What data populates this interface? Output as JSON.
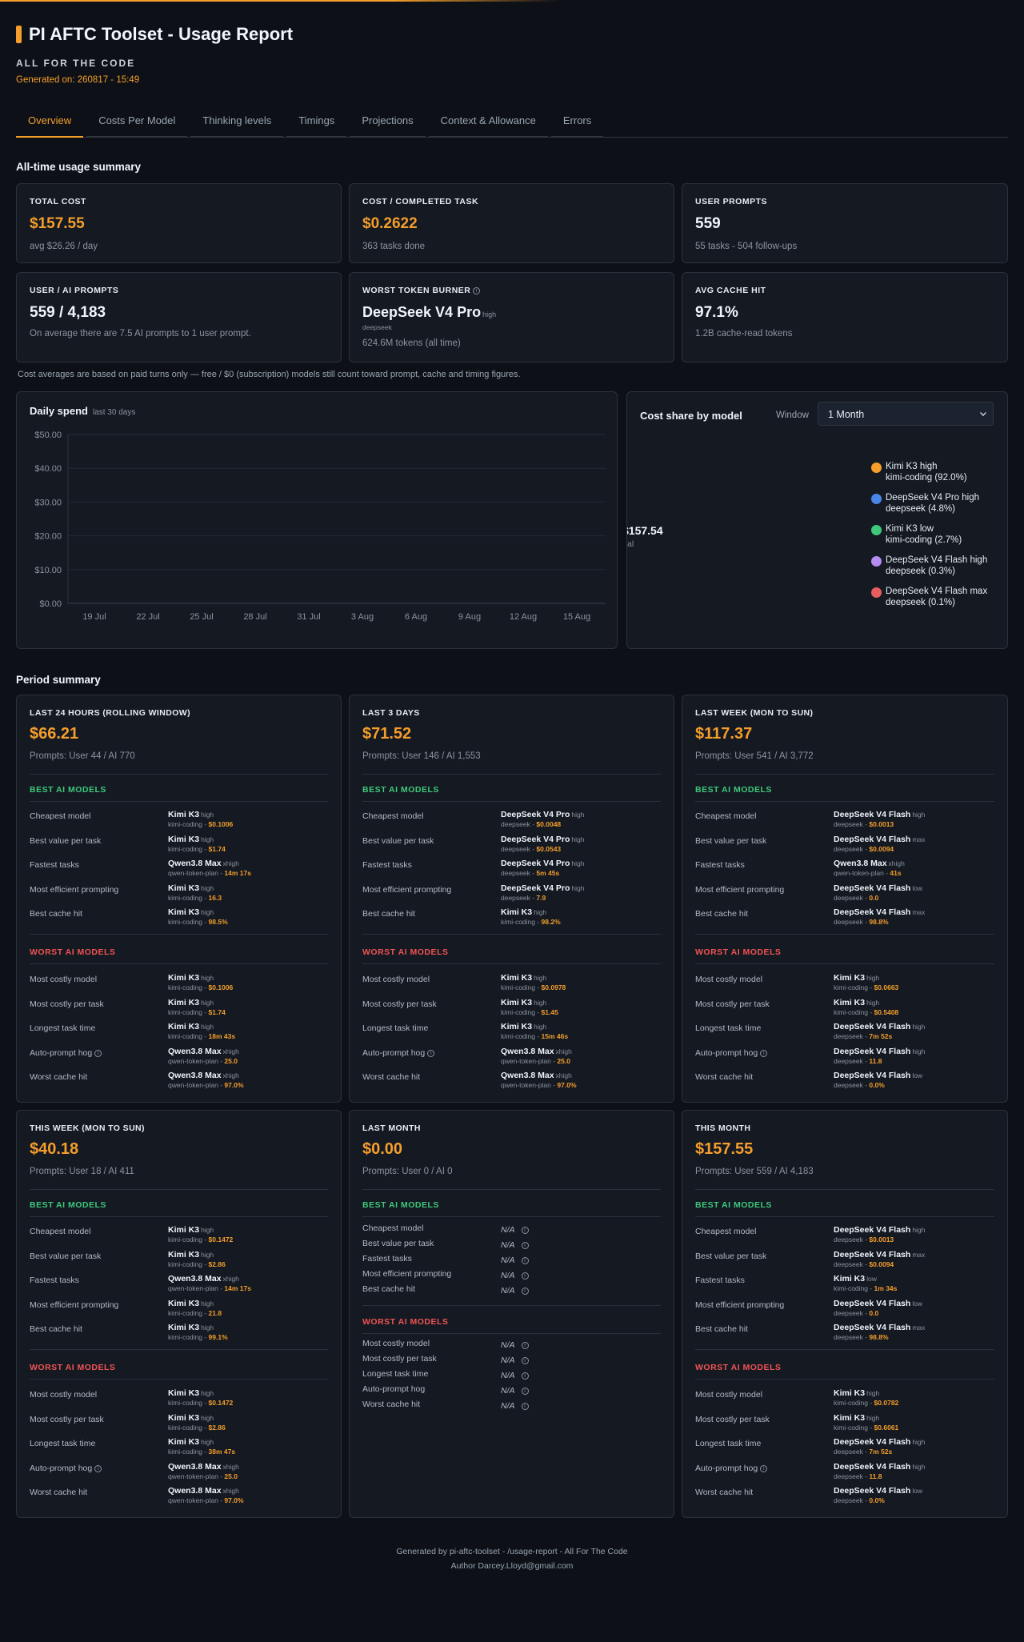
{
  "header": {
    "title": "PI AFTC Toolset - Usage Report",
    "subtitle": "ALL FOR THE CODE",
    "generated": "Generated on: 260817 - 15:49"
  },
  "tabs": [
    "Overview",
    "Costs Per Model",
    "Thinking levels",
    "Timings",
    "Projections",
    "Context & Allowance",
    "Errors"
  ],
  "summary": {
    "title": "All-time usage summary",
    "total_cost": {
      "label": "TOTAL COST",
      "value": "$157.55",
      "sub": "avg $26.26 / day"
    },
    "cost_per_task": {
      "label": "COST / COMPLETED TASK",
      "value": "$0.2622",
      "sub": "363 tasks done"
    },
    "user_prompts": {
      "label": "USER PROMPTS",
      "value": "559",
      "sub": "55 tasks - 504 follow-ups"
    },
    "user_ai": {
      "label": "USER / AI PROMPTS",
      "value": "559 / 4,183",
      "sub": "On average there are 7.5 AI prompts to 1 user prompt."
    },
    "worst_burner": {
      "label": "WORST TOKEN BURNER",
      "model": "DeepSeek V4 Pro",
      "level": "high",
      "provider": "deepseek",
      "sub": "624.6M tokens (all time)"
    },
    "cache_hit": {
      "label": "AVG CACHE HIT",
      "value": "97.1%",
      "sub": "1.2B cache-read tokens"
    },
    "note": "Cost averages are based on paid turns only — free / $0 (subscription) models still count toward prompt, cache and timing figures."
  },
  "daily_spend": {
    "title": "Daily spend",
    "subtitle": "last 30 days"
  },
  "chart_data": {
    "type": "bar",
    "title": "Daily spend",
    "subtitle": "last 30 days",
    "y_ticks": [
      "$0.00",
      "$10.00",
      "$20.00",
      "$30.00",
      "$40.00",
      "$50.00"
    ],
    "ylim": [
      0,
      50
    ],
    "x_ticks": [
      "19 Jul",
      "22 Jul",
      "25 Jul",
      "28 Jul",
      "31 Jul",
      "3 Aug",
      "6 Aug",
      "9 Aug",
      "12 Aug",
      "15 Aug"
    ],
    "grid": true
  },
  "cost_share": {
    "title": "Cost share by model",
    "window_label": "Window",
    "window_value": "1 Month",
    "total_value": "$157.54",
    "total_label": "Total",
    "items": [
      {
        "name": "Kimi K3 high",
        "detail": "kimi-coding (92.0%)",
        "share": 92.0,
        "color": "#f59e2b"
      },
      {
        "name": "DeepSeek V4 Pro high",
        "detail": "deepseek (4.8%)",
        "share": 4.8,
        "color": "#4a86e8"
      },
      {
        "name": "Kimi K3 low",
        "detail": "kimi-coding (2.7%)",
        "share": 2.7,
        "color": "#3ec97a"
      },
      {
        "name": "DeepSeek V4 Flash high",
        "detail": "deepseek (0.3%)",
        "share": 0.3,
        "color": "#b48cf2"
      },
      {
        "name": "DeepSeek V4 Flash max",
        "detail": "deepseek (0.1%)",
        "share": 0.1,
        "color": "#e85d5d"
      }
    ]
  },
  "period": {
    "title": "Period summary",
    "best_heading": "BEST AI MODELS",
    "worst_heading": "WORST AI MODELS",
    "best_keys": [
      "Cheapest model",
      "Best value per task",
      "Fastest tasks",
      "Most efficient prompting",
      "Best cache hit"
    ],
    "worst_keys": [
      "Most costly model",
      "Most costly per task",
      "Longest task time",
      "Auto-prompt hog",
      "Worst cache hit"
    ],
    "cards": [
      {
        "label": "LAST 24 HOURS (ROLLING WINDOW)",
        "cost": "$66.21",
        "prompts": "Prompts: User 44 / AI 770",
        "best": [
          {
            "m": "Kimi K3",
            "l": "high",
            "p": "kimi-coding - ",
            "v": "$0.1006"
          },
          {
            "m": "Kimi K3",
            "l": "high",
            "p": "kimi-coding - ",
            "v": "$1.74"
          },
          {
            "m": "Qwen3.8 Max",
            "l": "xhigh",
            "p": "qwen-token-plan - ",
            "v": "14m 17s"
          },
          {
            "m": "Kimi K3",
            "l": "high",
            "p": "kimi-coding - ",
            "v": "16.3"
          },
          {
            "m": "Kimi K3",
            "l": "high",
            "p": "kimi-coding - ",
            "v": "98.5%"
          }
        ],
        "worst": [
          {
            "m": "Kimi K3",
            "l": "high",
            "p": "kimi-coding - ",
            "v": "$0.1006"
          },
          {
            "m": "Kimi K3",
            "l": "high",
            "p": "kimi-coding - ",
            "v": "$1.74"
          },
          {
            "m": "Kimi K3",
            "l": "high",
            "p": "kimi-coding - ",
            "v": "18m 43s"
          },
          {
            "m": "Qwen3.8 Max",
            "l": "xhigh",
            "p": "qwen-token-plan - ",
            "v": "25.0"
          },
          {
            "m": "Qwen3.8 Max",
            "l": "xhigh",
            "p": "qwen-token-plan - ",
            "v": "97.0%"
          }
        ]
      },
      {
        "label": "LAST 3 DAYS",
        "cost": "$71.52",
        "prompts": "Prompts: User 146 / AI 1,553",
        "best": [
          {
            "m": "DeepSeek V4 Pro",
            "l": "high",
            "p": "deepseek - ",
            "v": "$0.0048"
          },
          {
            "m": "DeepSeek V4 Pro",
            "l": "high",
            "p": "deepseek - ",
            "v": "$0.0543"
          },
          {
            "m": "DeepSeek V4 Pro",
            "l": "high",
            "p": "deepseek - ",
            "v": "5m 45s"
          },
          {
            "m": "DeepSeek V4 Pro",
            "l": "high",
            "p": "deepseek - ",
            "v": "7.9"
          },
          {
            "m": "Kimi K3",
            "l": "high",
            "p": "kimi-coding - ",
            "v": "98.2%"
          }
        ],
        "worst": [
          {
            "m": "Kimi K3",
            "l": "high",
            "p": "kimi-coding - ",
            "v": "$0.0978"
          },
          {
            "m": "Kimi K3",
            "l": "high",
            "p": "kimi-coding - ",
            "v": "$1.45"
          },
          {
            "m": "Kimi K3",
            "l": "high",
            "p": "kimi-coding - ",
            "v": "15m 46s"
          },
          {
            "m": "Qwen3.8 Max",
            "l": "xhigh",
            "p": "qwen-token-plan - ",
            "v": "25.0"
          },
          {
            "m": "Qwen3.8 Max",
            "l": "xhigh",
            "p": "qwen-token-plan - ",
            "v": "97.0%"
          }
        ]
      },
      {
        "label": "LAST WEEK (MON TO SUN)",
        "cost": "$117.37",
        "prompts": "Prompts: User 541 / AI 3,772",
        "best": [
          {
            "m": "DeepSeek V4 Flash",
            "l": "high",
            "p": "deepseek - ",
            "v": "$0.0013"
          },
          {
            "m": "DeepSeek V4 Flash",
            "l": "max",
            "p": "deepseek - ",
            "v": "$0.0094"
          },
          {
            "m": "Qwen3.8 Max",
            "l": "xhigh",
            "p": "qwen-token-plan - ",
            "v": "41s"
          },
          {
            "m": "DeepSeek V4 Flash",
            "l": "low",
            "p": "deepseek - ",
            "v": "0.0"
          },
          {
            "m": "DeepSeek V4 Flash",
            "l": "max",
            "p": "deepseek - ",
            "v": "98.8%"
          }
        ],
        "worst": [
          {
            "m": "Kimi K3",
            "l": "high",
            "p": "kimi-coding - ",
            "v": "$0.0663"
          },
          {
            "m": "Kimi K3",
            "l": "high",
            "p": "kimi-coding - ",
            "v": "$0.5408"
          },
          {
            "m": "DeepSeek V4 Flash",
            "l": "high",
            "p": "deepseek - ",
            "v": "7m 52s"
          },
          {
            "m": "DeepSeek V4 Flash",
            "l": "high",
            "p": "deepseek - ",
            "v": "11.8"
          },
          {
            "m": "DeepSeek V4 Flash",
            "l": "low",
            "p": "deepseek - ",
            "v": "0.0%"
          }
        ]
      },
      {
        "label": "THIS WEEK (MON TO SUN)",
        "cost": "$40.18",
        "prompts": "Prompts: User 18 / AI 411",
        "best": [
          {
            "m": "Kimi K3",
            "l": "high",
            "p": "kimi-coding - ",
            "v": "$0.1472"
          },
          {
            "m": "Kimi K3",
            "l": "high",
            "p": "kimi-coding - ",
            "v": "$2.86"
          },
          {
            "m": "Qwen3.8 Max",
            "l": "xhigh",
            "p": "qwen-token-plan - ",
            "v": "14m 17s"
          },
          {
            "m": "Kimi K3",
            "l": "high",
            "p": "kimi-coding - ",
            "v": "21.8"
          },
          {
            "m": "Kimi K3",
            "l": "high",
            "p": "kimi-coding - ",
            "v": "99.1%"
          }
        ],
        "worst": [
          {
            "m": "Kimi K3",
            "l": "high",
            "p": "kimi-coding - ",
            "v": "$0.1472"
          },
          {
            "m": "Kimi K3",
            "l": "high",
            "p": "kimi-coding - ",
            "v": "$2.86"
          },
          {
            "m": "Kimi K3",
            "l": "high",
            "p": "kimi-coding - ",
            "v": "38m 47s"
          },
          {
            "m": "Qwen3.8 Max",
            "l": "xhigh",
            "p": "qwen-token-plan - ",
            "v": "25.0"
          },
          {
            "m": "Qwen3.8 Max",
            "l": "xhigh",
            "p": "qwen-token-plan - ",
            "v": "97.0%"
          }
        ]
      },
      {
        "label": "LAST MONTH",
        "cost": "$0.00",
        "prompts": "Prompts: User 0 / AI 0",
        "na": "N/A"
      },
      {
        "label": "THIS MONTH",
        "cost": "$157.55",
        "prompts": "Prompts: User 559 / AI 4,183",
        "best": [
          {
            "m": "DeepSeek V4 Flash",
            "l": "high",
            "p": "deepseek - ",
            "v": "$0.0013"
          },
          {
            "m": "DeepSeek V4 Flash",
            "l": "max",
            "p": "deepseek - ",
            "v": "$0.0094"
          },
          {
            "m": "Kimi K3",
            "l": "low",
            "p": "kimi-coding - ",
            "v": "1m 34s"
          },
          {
            "m": "DeepSeek V4 Flash",
            "l": "low",
            "p": "deepseek - ",
            "v": "0.0"
          },
          {
            "m": "DeepSeek V4 Flash",
            "l": "max",
            "p": "deepseek - ",
            "v": "98.8%"
          }
        ],
        "worst": [
          {
            "m": "Kimi K3",
            "l": "high",
            "p": "kimi-coding - ",
            "v": "$0.0782"
          },
          {
            "m": "Kimi K3",
            "l": "high",
            "p": "kimi-coding - ",
            "v": "$0.6061"
          },
          {
            "m": "DeepSeek V4 Flash",
            "l": "high",
            "p": "deepseek - ",
            "v": "7m 52s"
          },
          {
            "m": "DeepSeek V4 Flash",
            "l": "high",
            "p": "deepseek - ",
            "v": "11.8"
          },
          {
            "m": "DeepSeek V4 Flash",
            "l": "low",
            "p": "deepseek - ",
            "v": "0.0%"
          }
        ]
      }
    ]
  },
  "footer": {
    "line1": "Generated by pi-aftc-toolset - /usage-report - All For The Code",
    "line2": "Author Darcey.Lloyd@gmail.com"
  }
}
